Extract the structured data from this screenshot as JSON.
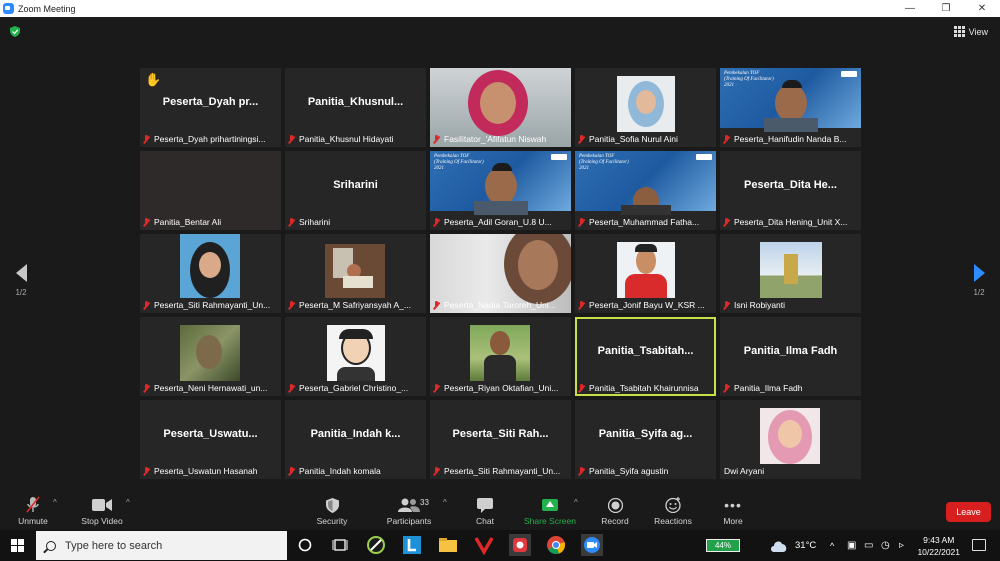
{
  "window": {
    "title": "Zoom Meeting",
    "view_label": "View"
  },
  "pager": {
    "left_page": "1/2",
    "right_page": "1/2"
  },
  "participants": [
    {
      "big": "Peserta_Dyah   pr...",
      "label": "Peserta_Dyah prihartiningsi...",
      "muted": true,
      "hand": true
    },
    {
      "big": "Panitia_Khusnul...",
      "label": "Panitia_Khusnul Hidayati",
      "muted": true
    },
    {
      "big": "",
      "label": "Fasilitator_'Afifatun Niswah",
      "muted": true,
      "video": "hijab-pink"
    },
    {
      "big": "",
      "label": "Panitia_Sofia Nurul Aini",
      "muted": true,
      "video": "hijab-photo"
    },
    {
      "big": "",
      "label": "Peserta_Hanifudin Nanda B...",
      "muted": true,
      "video": "banner-man"
    },
    {
      "big": "",
      "label": "Panitia_Bentar Ali",
      "muted": true,
      "video": "dark"
    },
    {
      "big": "Sriharini",
      "label": "Sriharini",
      "muted": true
    },
    {
      "big": "",
      "label": "Peserta_Adil Goran_U.8 U...",
      "muted": true,
      "video": "banner-man"
    },
    {
      "big": "",
      "label": "Peserta_Muhammad Fatha...",
      "muted": true,
      "video": "banner-man2"
    },
    {
      "big": "Peserta_Dita   He...",
      "label": "Peserta_Dita Hening_Unit X...",
      "muted": true
    },
    {
      "big": "",
      "label": "Peserta_Siti Rahmayanti_Un...",
      "muted": true,
      "video": "hijab-black"
    },
    {
      "big": "",
      "label": "Peserta_M Safriyansyah A_...",
      "muted": true,
      "video": "desk"
    },
    {
      "big": "",
      "label": "Peserta_Nadia Taroreh_Uni...",
      "muted": true,
      "video": "closeup"
    },
    {
      "big": "",
      "label": "Peserta_Jonif Bayu W_KSR ...",
      "muted": true,
      "video": "red-shirt"
    },
    {
      "big": "",
      "label": "Isni Robiyanti",
      "muted": true,
      "video": "monument"
    },
    {
      "big": "",
      "label": "Peserta_Neni Hernawati_un...",
      "muted": true,
      "video": "plants"
    },
    {
      "big": "",
      "label": "Peserta_Gabriel Christino_...",
      "muted": true,
      "video": "cartoon"
    },
    {
      "big": "",
      "label": "Peserta_Riyan Oktafian_Uni...",
      "muted": true,
      "video": "outdoor-man"
    },
    {
      "big": "Panitia_Tsabitah...",
      "label": "Panitia_Tsabitah Khairunnisa",
      "muted": true,
      "speaker": true
    },
    {
      "big": "Panitia_Ilma Fadh",
      "label": "Panitia_Ilma Fadh",
      "muted": true
    },
    {
      "big": "Peserta_Uswatu...",
      "label": "Peserta_Uswatun Hasanah",
      "muted": true
    },
    {
      "big": "Panitia_Indah   k...",
      "label": "Panitia_Indah komala",
      "muted": true
    },
    {
      "big": "Peserta_Siti   Rah...",
      "label": "Peserta_Siti Rahmayanti_Un...",
      "muted": true
    },
    {
      "big": "Panitia_Syifa   ag...",
      "label": "Panitia_Syifa agustin",
      "muted": true
    },
    {
      "big": "",
      "label": "Dwi Aryani",
      "muted": false,
      "video": "pink-hijab-girl"
    }
  ],
  "banner_text": "Pembekalan TOF\n(Training Of Facilitator)\n2021",
  "toolbar": {
    "unmute": "Unmute",
    "stop_video": "Stop Video",
    "security": "Security",
    "participants": "Participants",
    "participants_count": "33",
    "chat": "Chat",
    "share_screen": "Share Screen",
    "record": "Record",
    "reactions": "Reactions",
    "more": "More",
    "leave": "Leave"
  },
  "taskbar": {
    "search_placeholder": "Type here to search",
    "battery": "44%",
    "temperature": "31°C",
    "time": "9:43 AM",
    "date": "10/22/2021"
  },
  "colors": {
    "accent": "#2d8cff",
    "leave": "#d71f1f",
    "share": "#22b14c",
    "speaker_border": "#c8e045",
    "muted_mic": "#e02828"
  }
}
